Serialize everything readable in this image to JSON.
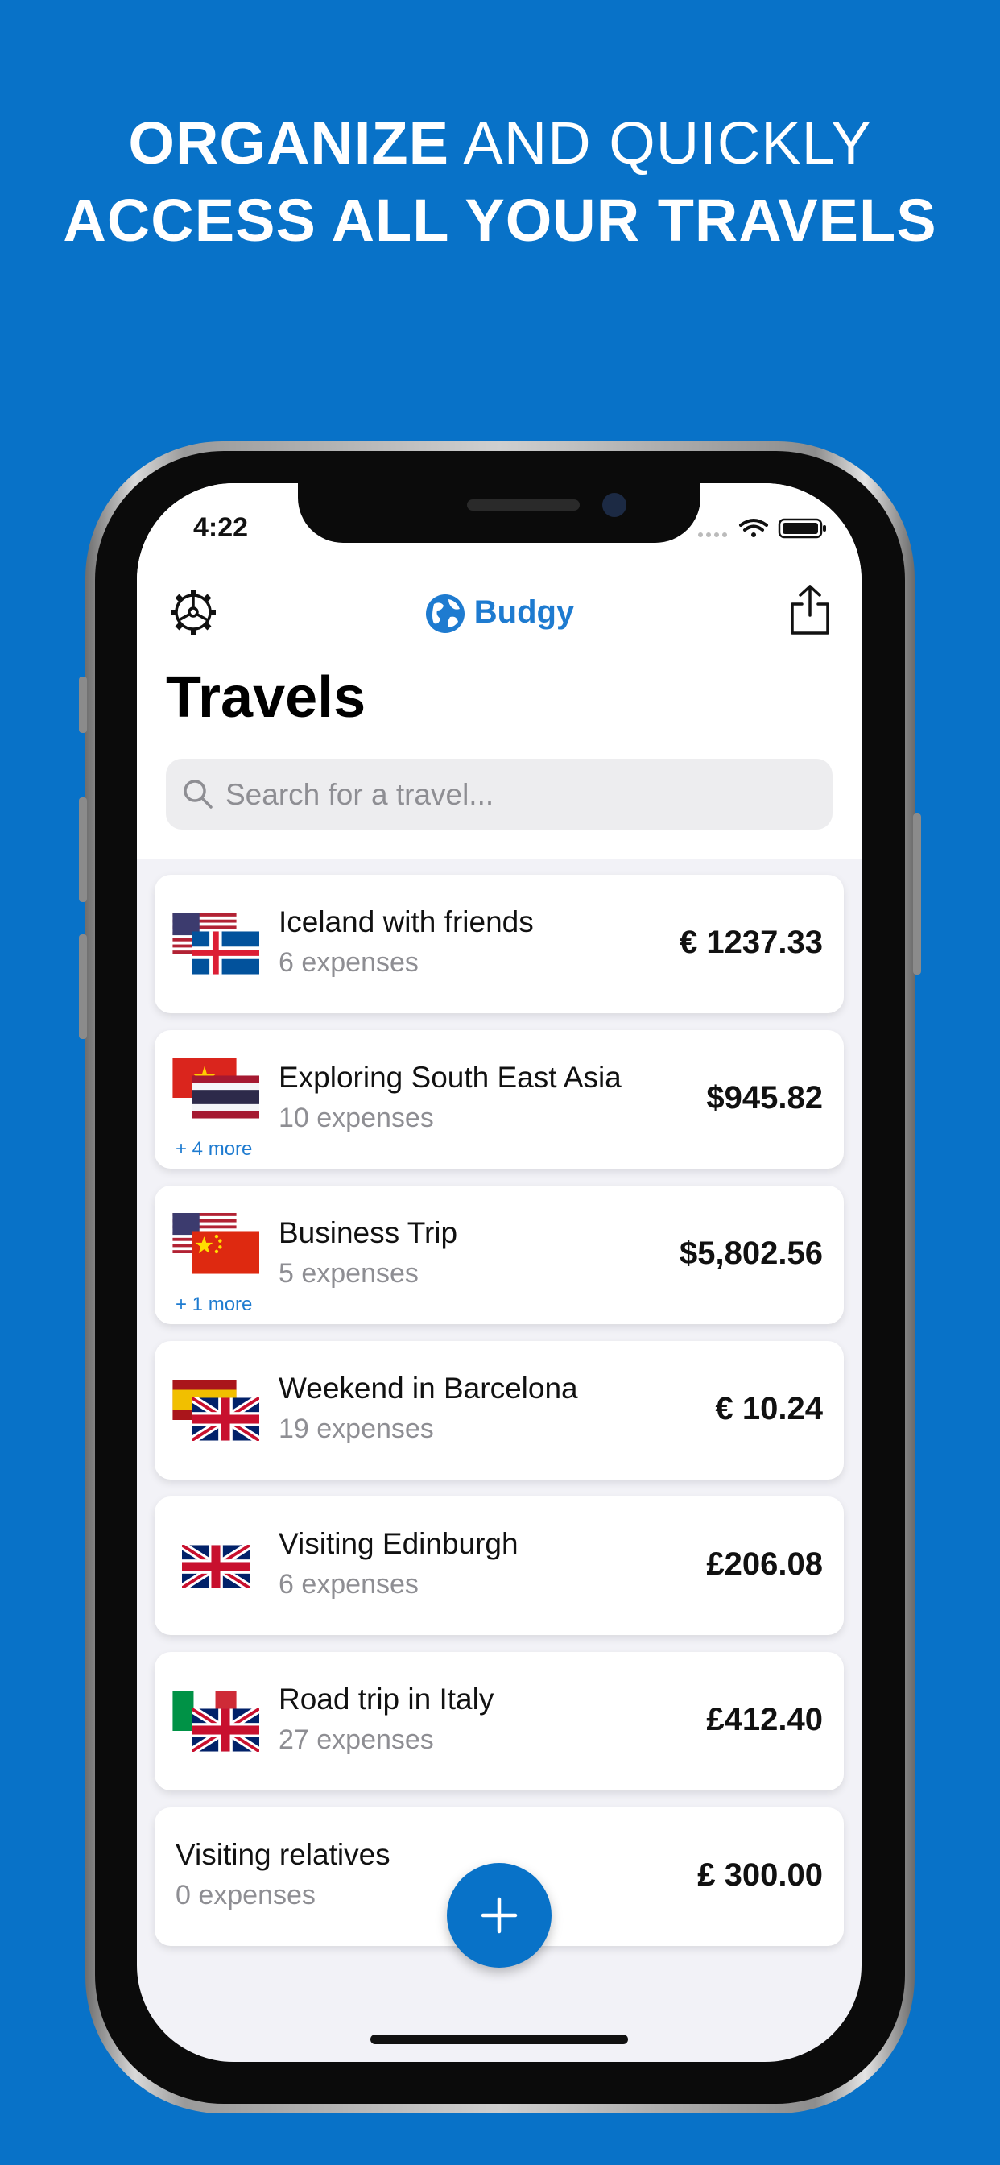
{
  "headline": {
    "line1_bold": "ORGANIZE",
    "line1_light": " AND QUICKLY",
    "line2": "ACCESS ALL YOUR TRAVELS"
  },
  "status": {
    "time": "4:22"
  },
  "nav": {
    "brand": "Budgy"
  },
  "page": {
    "title": "Travels"
  },
  "search": {
    "placeholder": "Search for a travel..."
  },
  "travels": [
    {
      "title": "Iceland with friends",
      "expenses": "6 expenses",
      "amount": "€ 1237.33",
      "more": ""
    },
    {
      "title": "Exploring South East Asia",
      "expenses": "10 expenses",
      "amount": "$945.82",
      "more": "+ 4 more"
    },
    {
      "title": "Business Trip",
      "expenses": "5 expenses",
      "amount": "$5,802.56",
      "more": "+ 1 more"
    },
    {
      "title": "Weekend in Barcelona",
      "expenses": "19 expenses",
      "amount": "€ 10.24",
      "more": ""
    },
    {
      "title": "Visiting Edinburgh",
      "expenses": "6 expenses",
      "amount": "£206.08",
      "more": ""
    },
    {
      "title": "Road trip in Italy",
      "expenses": "27 expenses",
      "amount": "£412.40",
      "more": ""
    },
    {
      "title": "Visiting relatives",
      "expenses": "0 expenses",
      "amount": "£ 300.00",
      "more": ""
    }
  ],
  "icons": {
    "settings": "gear-icon",
    "share": "share-icon",
    "search": "search-icon",
    "add": "plus-icon",
    "brand": "globe-icon"
  },
  "colors": {
    "background": "#0872C8",
    "accent": "#1E7BD0",
    "screen_bg": "#F2F2F7"
  }
}
